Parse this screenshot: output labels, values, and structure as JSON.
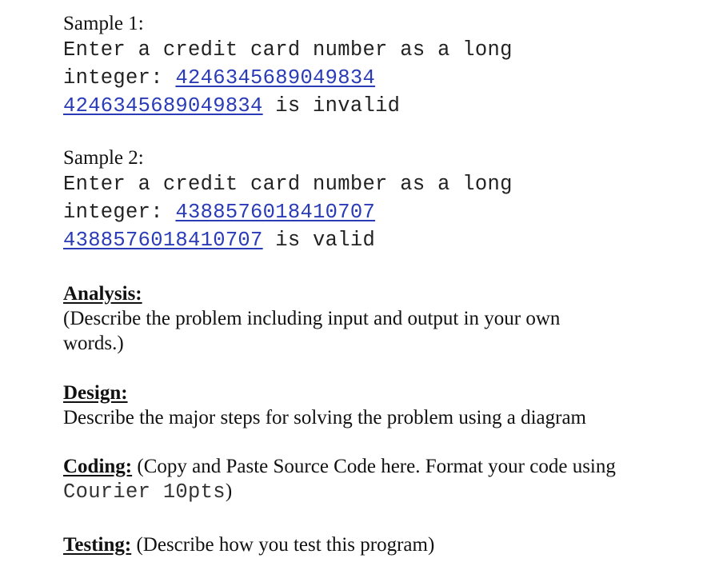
{
  "samples": [
    {
      "title": "Sample 1:",
      "prompt_line1": "Enter a credit card number as a long",
      "prompt_line2_prefix": "integer: ",
      "input_value": "4246345689049834",
      "output_number": "4246345689049834",
      "output_suffix": " is invalid"
    },
    {
      "title": "Sample 2:",
      "prompt_line1": "Enter a credit card number as a long",
      "prompt_line2_prefix": "integer: ",
      "input_value": "4388576018410707",
      "output_number": "4388576018410707",
      "output_suffix": " is valid"
    }
  ],
  "analysis": {
    "heading": "Analysis:",
    "line1": "(Describe the problem including input and output in your own",
    "line2": "words.)"
  },
  "design": {
    "heading": "Design:",
    "line1": "Describe the major steps for solving the problem using a diagram"
  },
  "coding": {
    "heading": "Coding:",
    "line1": " (Copy and Paste Source Code here. Format your code using",
    "line2_mono": "Courier 10pts",
    "line2_end": ")"
  },
  "testing": {
    "heading": "Testing:",
    "line1": " (Describe how you test this program)"
  },
  "colors": {
    "link": "#2a3bb8",
    "text": "#111111"
  }
}
